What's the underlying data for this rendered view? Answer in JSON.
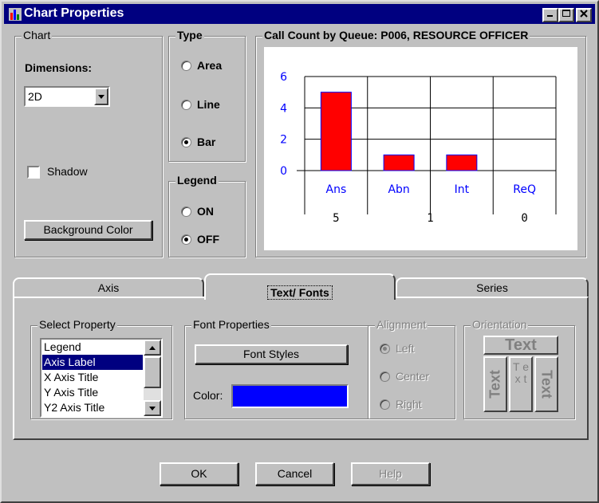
{
  "window": {
    "title": "Chart Properties"
  },
  "chart_group": {
    "title": "Chart",
    "dimensions_label": "Dimensions:",
    "dimensions_value": "2D",
    "shadow_label": "Shadow",
    "shadow_checked": false,
    "background_button": "Background Color"
  },
  "type_group": {
    "title": "Type",
    "options": [
      {
        "label": "Area",
        "checked": false
      },
      {
        "label": "Line",
        "checked": false
      },
      {
        "label": "Bar",
        "checked": true
      }
    ]
  },
  "legend_group": {
    "title": "Legend",
    "options": [
      {
        "label": "ON",
        "checked": false
      },
      {
        "label": "OFF",
        "checked": true
      }
    ]
  },
  "chart_preview": {
    "title": "Call Count by Queue: P006, RESOURCE OFFICER",
    "y_ticks": [
      "6",
      "4",
      "2",
      "0"
    ],
    "categories": [
      "Ans",
      "Abn",
      "Int",
      "ReQ"
    ],
    "values": [
      5,
      1,
      1,
      0
    ],
    "value_labels": [
      "5",
      "1",
      "0"
    ],
    "bar_color": "#ff0000",
    "axis_label_color": "#0000ff"
  },
  "tabs": [
    {
      "label": "Axis",
      "active": false
    },
    {
      "label": "Text/ Fonts",
      "active": true
    },
    {
      "label": "Series",
      "active": false
    }
  ],
  "select_property": {
    "title": "Select Property",
    "items": [
      "Legend",
      "Axis Label",
      "X Axis Title",
      "Y Axis Title",
      "Y2 Axis Title"
    ],
    "selected": "Axis Label"
  },
  "font_properties": {
    "title": "Font Properties",
    "font_styles_button": "Font Styles",
    "color_label": "Color:",
    "color_value": "#0000ff"
  },
  "alignment": {
    "title": "Alignment",
    "options": [
      {
        "label": "Left",
        "checked": true
      },
      {
        "label": "Center",
        "checked": false
      },
      {
        "label": "Right",
        "checked": false
      }
    ]
  },
  "orientation": {
    "title": "Orientation",
    "samples": [
      "Text",
      "Text",
      "T e x t",
      "Text"
    ]
  },
  "buttons": {
    "ok": "OK",
    "cancel": "Cancel",
    "help": "Help"
  }
}
